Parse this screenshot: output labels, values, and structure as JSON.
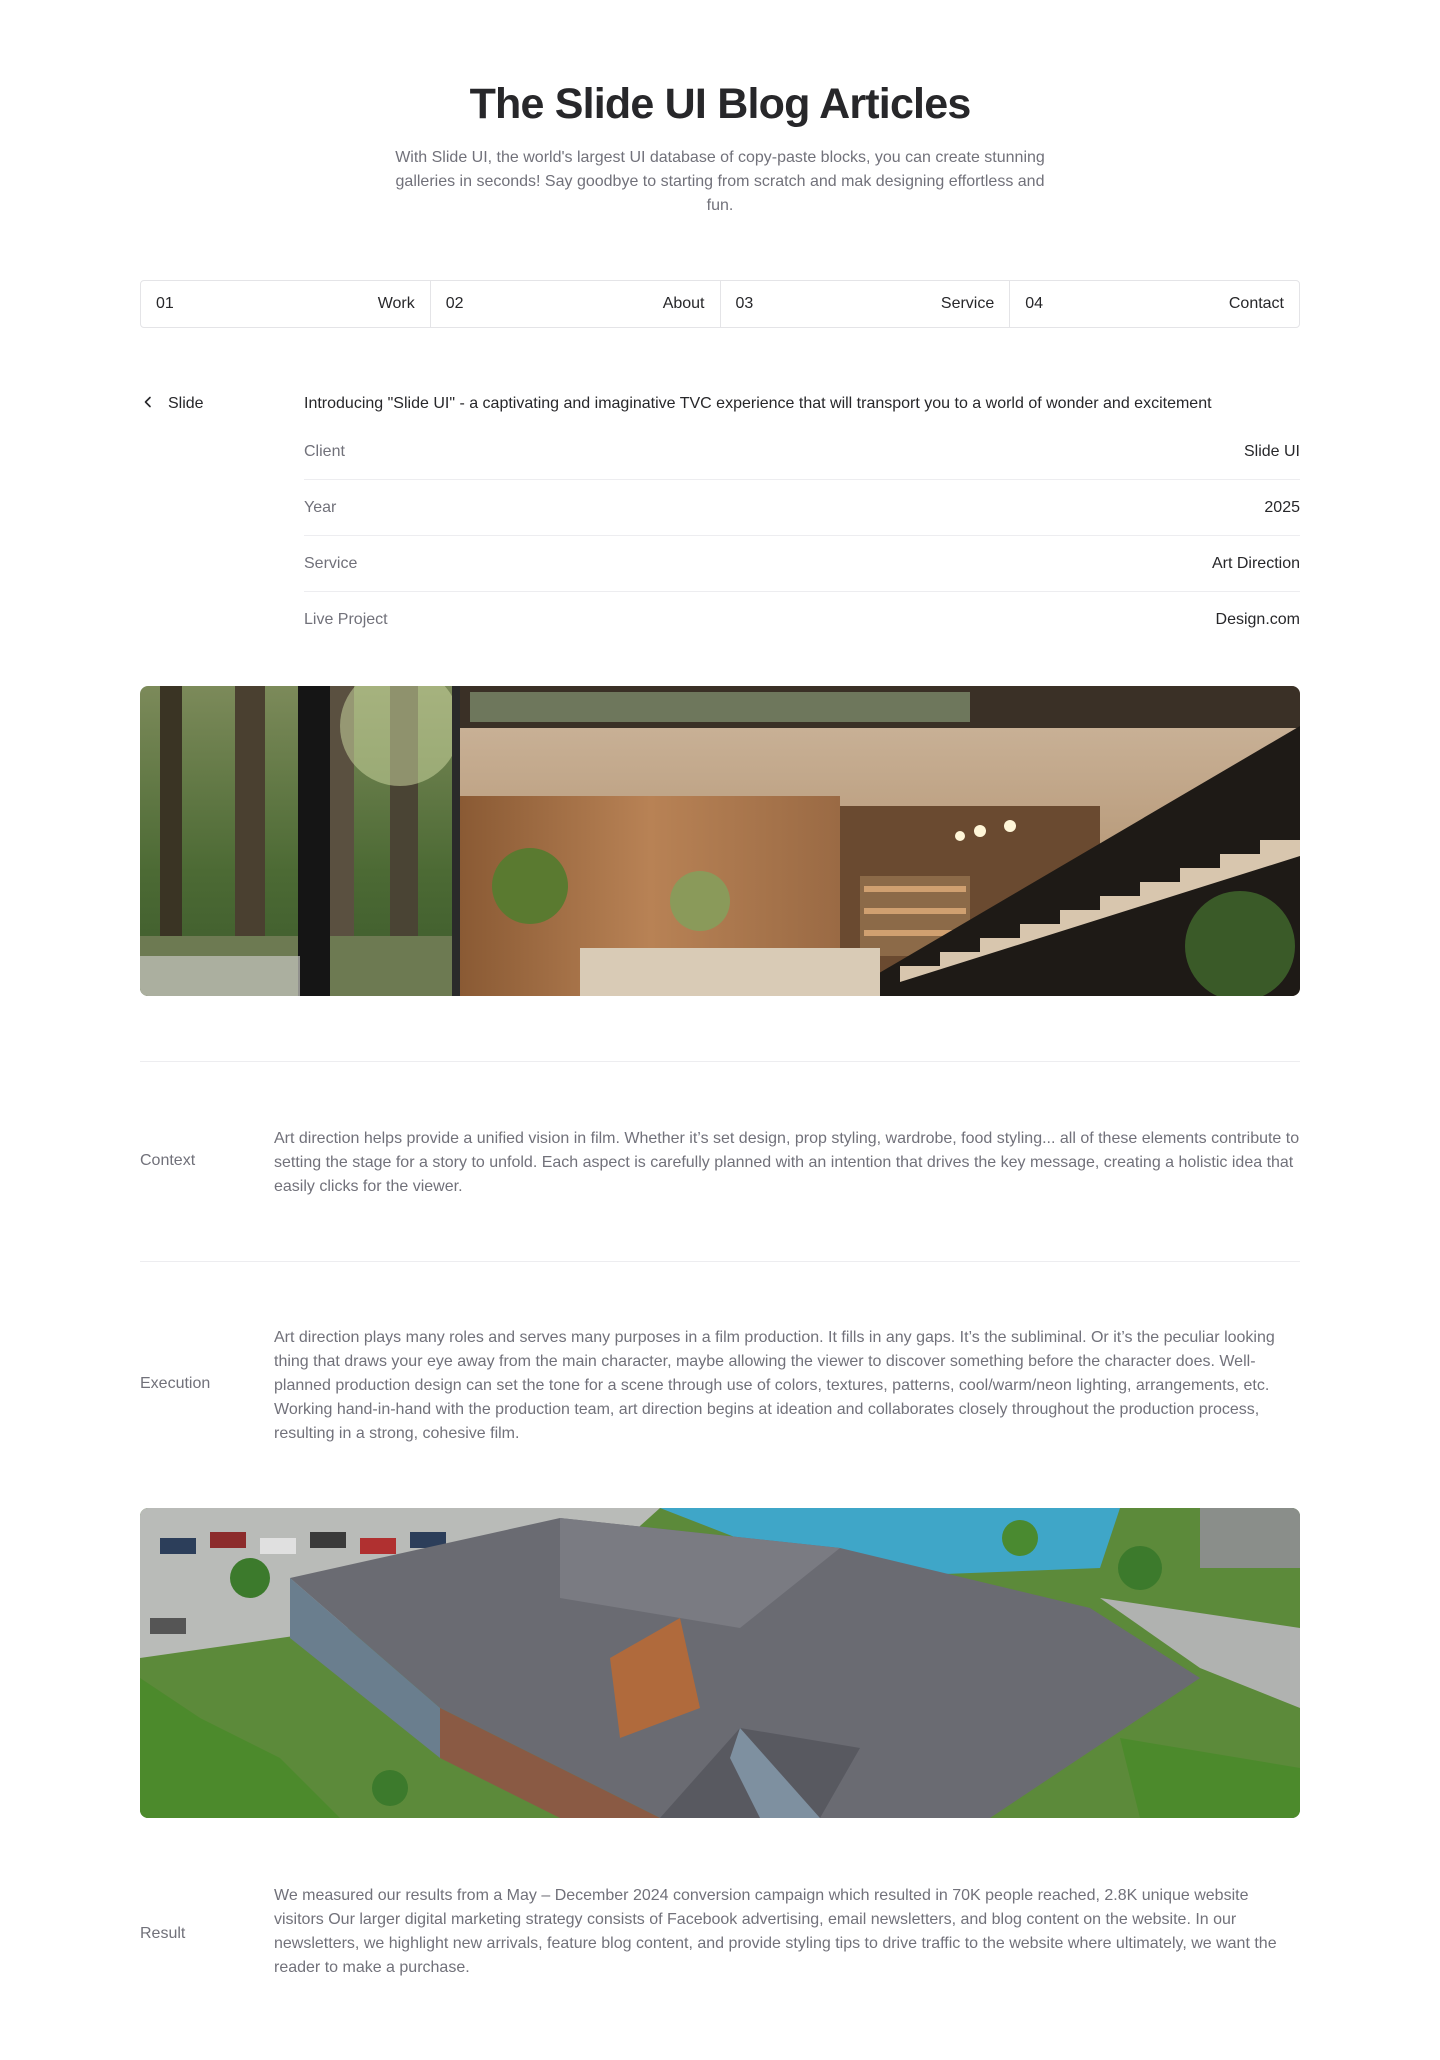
{
  "header": {
    "title": "The Slide UI Blog Articles",
    "subtitle": "With Slide UI, the world's largest UI database of copy-paste blocks, you can create stunning galleries in seconds! Say goodbye to starting from scratch and mak designing effortless and fun."
  },
  "tabs": [
    {
      "number": "01",
      "label": "Work"
    },
    {
      "number": "02",
      "label": "About"
    },
    {
      "number": "03",
      "label": "Service"
    },
    {
      "number": "04",
      "label": "Contact"
    }
  ],
  "project": {
    "back_label": "Slide",
    "intro": "Introducing \"Slide UI\" - a captivating and imaginative TVC experience that will transport you to a world of wonder and excitement",
    "details": [
      {
        "label": "Client",
        "value": "Slide UI"
      },
      {
        "label": "Year",
        "value": "2025"
      },
      {
        "label": "Service",
        "value": "Art Direction"
      },
      {
        "label": "Live Project",
        "value": "Design.com"
      }
    ]
  },
  "sections": {
    "context": {
      "label": "Context",
      "text": " Art direction helps provide a unified vision in film. Whether it’s set design, prop styling, wardrobe, food styling... all of these elements contribute to setting the stage for a story to unfold. Each aspect is carefully planned with an intention that drives the key message, creating a holistic idea that easily clicks for the viewer."
    },
    "execution": {
      "label": "Execution",
      "text": "Art direction plays many roles and serves many purposes in a film production. It fills in any gaps. It’s the subliminal. Or it’s the peculiar looking thing that draws your eye away from the main character, maybe allowing the viewer to discover something before the character does. Well-planned production design can set the tone for a scene through use of colors, textures, patterns, cool/warm/neon lighting, arrangements, etc. Working hand-in-hand with the production team, art direction begins at ideation and collaborates closely throughout the production process, resulting in a strong, cohesive film."
    },
    "result": {
      "label": "Result",
      "text": "We measured our results from a May – December 2024 conversion campaign which resulted in 70K people reached, 2.8K unique website visitors Our larger digital marketing strategy consists of Facebook advertising, email newsletters, and blog content on the website. In our newsletters, we highlight new arrivals, feature blog content, and provide styling tips to drive traffic to the website where ultimately, we want the reader to make a purchase."
    }
  },
  "images": {
    "interior": "photo of modern interior with forest view and wooden staircase",
    "building": "aerial photo of apartment building with parking lot and lake"
  }
}
